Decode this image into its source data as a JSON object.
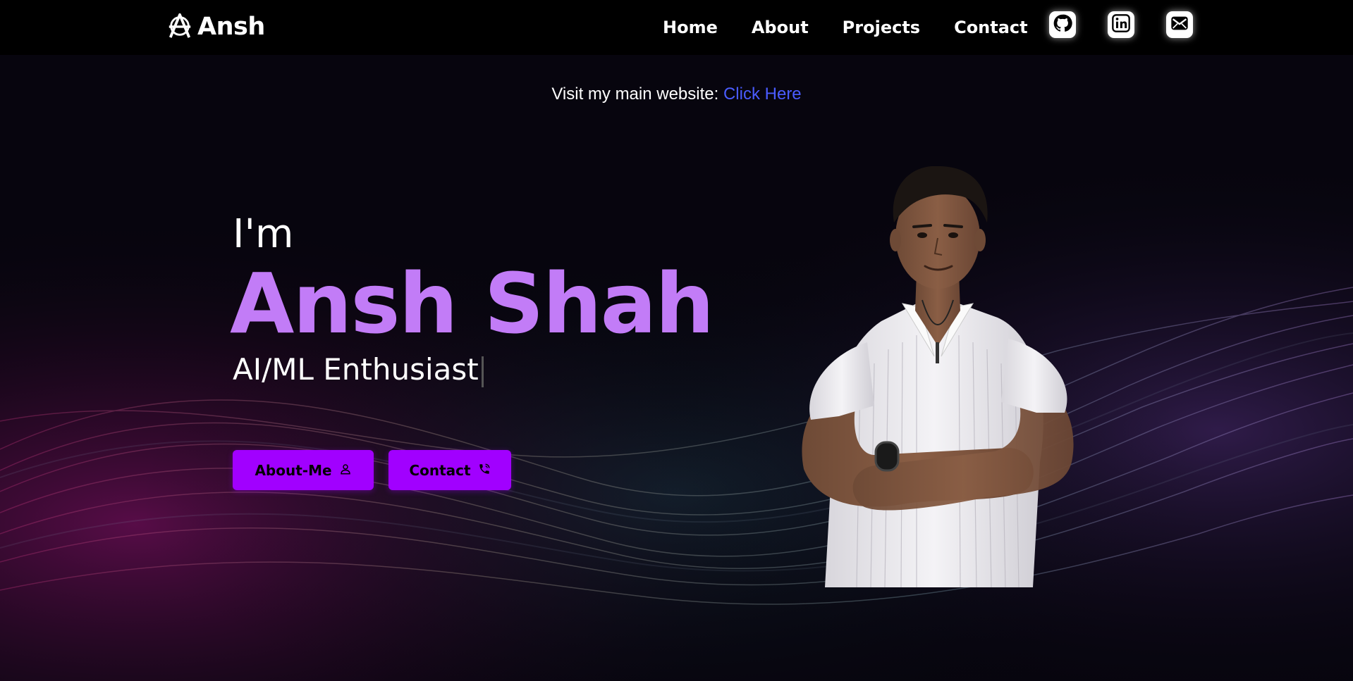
{
  "brand": {
    "name": "Ansh",
    "icon": "anarchy-logo-icon"
  },
  "nav": {
    "links": [
      {
        "label": "Home"
      },
      {
        "label": "About"
      },
      {
        "label": "Projects"
      },
      {
        "label": "Contact"
      }
    ],
    "socials": [
      {
        "icon": "github-icon"
      },
      {
        "icon": "linkedin-icon"
      },
      {
        "icon": "mail-icon"
      }
    ]
  },
  "notice": {
    "text": "Visit my main website: ",
    "link_label": "Click Here"
  },
  "hero": {
    "greeting": "I'm",
    "name": "Ansh Shah",
    "role": "AI/ML Enthusiast",
    "buttons": [
      {
        "label": "About-Me",
        "icon": "user-icon"
      },
      {
        "label": "Contact",
        "icon": "phone-icon"
      }
    ]
  },
  "colors": {
    "accent": "#a100ff",
    "name": "#c27cf7",
    "link": "#4a5cff",
    "background": "#07050e"
  }
}
